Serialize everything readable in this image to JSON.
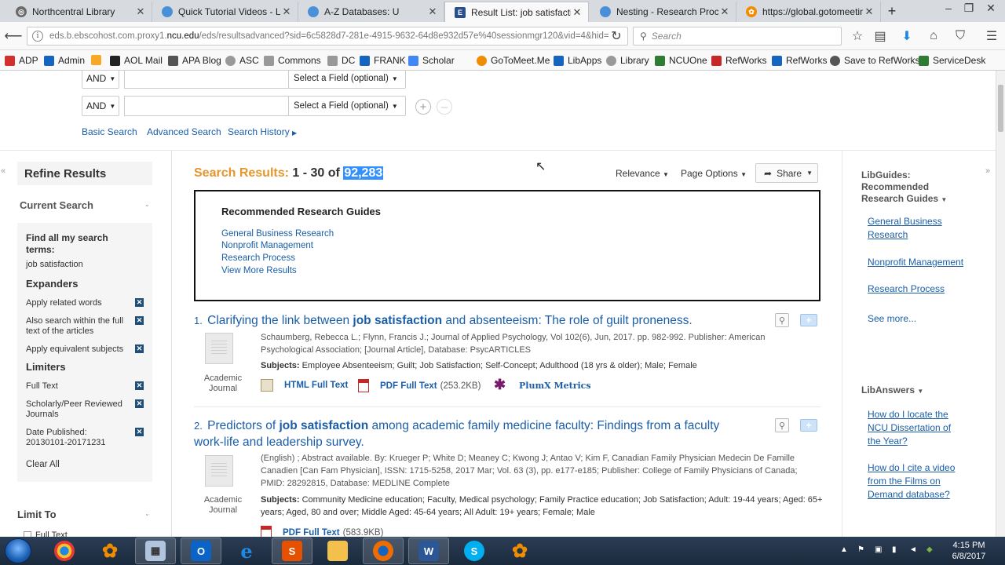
{
  "browser": {
    "tabs": [
      {
        "label": "Northcentral Library",
        "icon": "library-icon",
        "color": "#6b6b6b",
        "active": false
      },
      {
        "label": "Quick Tutorial Videos - Le",
        "icon": "page-icon",
        "color": "#4a90d9",
        "active": false
      },
      {
        "label": "A-Z Databases: U",
        "icon": "page-icon",
        "color": "#4a90d9",
        "active": false
      },
      {
        "label": "Result List: job satisfaction",
        "icon": "ebsco-icon",
        "color": "#2a4f8f",
        "active": true
      },
      {
        "label": "Nesting - Research Proces",
        "icon": "page-icon",
        "color": "#4a90d9",
        "active": false
      },
      {
        "label": "https://global.gotomeetin",
        "icon": "gotomeeting-icon",
        "color": "#f08c00",
        "active": false
      }
    ],
    "url_prefix": "eds.b.ebscohost.com.proxy1.",
    "url_domain": "ncu.edu",
    "url_suffix": "/eds/resultsadvanced?sid=6c5828d7-281e-4915-9632-64d8e932d57e%40sessionmgr120&vid=4&hid=",
    "search_placeholder": "Search",
    "bookmarks": [
      {
        "label": "ADP",
        "color": "#d32f2f"
      },
      {
        "label": "Admin",
        "color": "#1565c0"
      },
      {
        "label": "",
        "color": "#f9a825"
      },
      {
        "label": "AOL Mail",
        "color": "#222222"
      },
      {
        "label": "APA Blog",
        "color": "#555555"
      },
      {
        "label": "ASC",
        "color": "#777777"
      },
      {
        "label": "Commons",
        "color": "#777777"
      },
      {
        "label": "DC",
        "color": "#777777"
      },
      {
        "label": "FRANK",
        "color": "#1565c0"
      },
      {
        "label": "Scholar",
        "color": "#4285f4"
      },
      {
        "label": "GoToMeet.Me",
        "color": "#f08c00"
      },
      {
        "label": "LibApps",
        "color": "#1565c0"
      },
      {
        "label": "Library",
        "color": "#777777"
      },
      {
        "label": "NCUOne",
        "color": "#2e7d32"
      },
      {
        "label": "RefWorks",
        "color": "#c62828"
      },
      {
        "label": "RefWorks",
        "color": "#1565c0"
      },
      {
        "label": "Save to RefWorks",
        "color": "#555555"
      },
      {
        "label": "ServiceDesk",
        "color": "#2e7d32"
      }
    ]
  },
  "search_form": {
    "row1": {
      "bool": "AND",
      "field": "Select a Field (optional)"
    },
    "row2": {
      "bool": "AND",
      "field": "Select a Field (optional)"
    },
    "links": [
      "Basic Search",
      "Advanced Search",
      "Search History"
    ]
  },
  "refine": {
    "title": "Refine Results",
    "current_search": "Current Search",
    "find_all": "Find all my search terms:",
    "query": "job satisfaction",
    "expanders_head": "Expanders",
    "expanders": [
      "Apply related words",
      "Also search within the full text of the articles",
      "Apply equivalent subjects"
    ],
    "limiters_head": "Limiters",
    "limiters": [
      "Full Text",
      "Scholarly/Peer Reviewed Journals",
      "Date Published: 20130101-20171231"
    ],
    "clear_all": "Clear All",
    "limit_to": "Limit To",
    "limit_to_first": "Full Text"
  },
  "results": {
    "label": "Search Results:",
    "range": "1 - 30 of",
    "total": "92,283",
    "relevance": "Relevance",
    "page_options": "Page Options",
    "share": "Share",
    "guides_title": "Recommended Research Guides",
    "guides": [
      "General Business Research",
      "Nonprofit Management",
      "Research Process",
      "View More Results"
    ],
    "items": [
      {
        "num": "1.",
        "title_pre": "Clarifying the link between",
        "title_bold": "job satisfaction",
        "title_post": "and absenteeism: The role of guilt proneness.",
        "type": "Academic Journal",
        "meta": "Schaumberg, Rebecca L.; Flynn, Francis J.; Journal of Applied Psychology, Vol 102(6), Jun, 2017. pp. 982-992. Publisher: American Psychological Association; [Journal Article], Database: PsycARTICLES",
        "subjects_label": "Subjects:",
        "subjects": "Employee Absenteeism; Guilt; Job Satisfaction; Self-Concept; Adulthood (18 yrs & older); Male; Female",
        "html": "HTML Full Text",
        "pdf": "PDF Full Text",
        "pdf_size": "(253.2KB)",
        "plumx": "PlumX Metrics"
      },
      {
        "num": "2.",
        "title_pre": "Predictors of",
        "title_bold": "job satisfaction",
        "title_post": "among academic family medicine faculty: Findings from a faculty work-life and leadership survey.",
        "type": "Academic Journal",
        "meta": "(English) ; Abstract available. By: Krueger P; White D; Meaney C; Kwong J; Antao V; Kim F, Canadian Family Physician Medecin De Famille Canadien [Can Fam Physician], ISSN: 1715-5258, 2017 Mar; Vol. 63 (3), pp. e177-e185; Publisher: College of Family Physicians of Canada; PMID: 28292815, Database: MEDLINE Complete",
        "subjects_label": "Subjects:",
        "subjects": "Community Medicine education; Faculty, Medical psychology; Family Practice education; Job Satisfaction; Adult: 19-44 years; Aged: 65+ years; Aged, 80 and over; Middle Aged: 45-64 years; All Adult: 19+ years; Female; Male",
        "pdf": "PDF Full Text",
        "pdf_size": "(583.9KB)"
      }
    ]
  },
  "right_panel": {
    "libguides_head": "LibGuides: Recommended Research Guides",
    "libguides": [
      "General Business Research",
      "Nonprofit Management",
      "Research Process"
    ],
    "see_more": "See more...",
    "libanswers_head": "LibAnswers",
    "libanswers": [
      "How do I locate the NCU Dissertation of the Year?",
      "How do I cite a video from the Films on Demand database?"
    ]
  },
  "taskbar": {
    "time": "4:15 PM",
    "date": "6/8/2017"
  }
}
